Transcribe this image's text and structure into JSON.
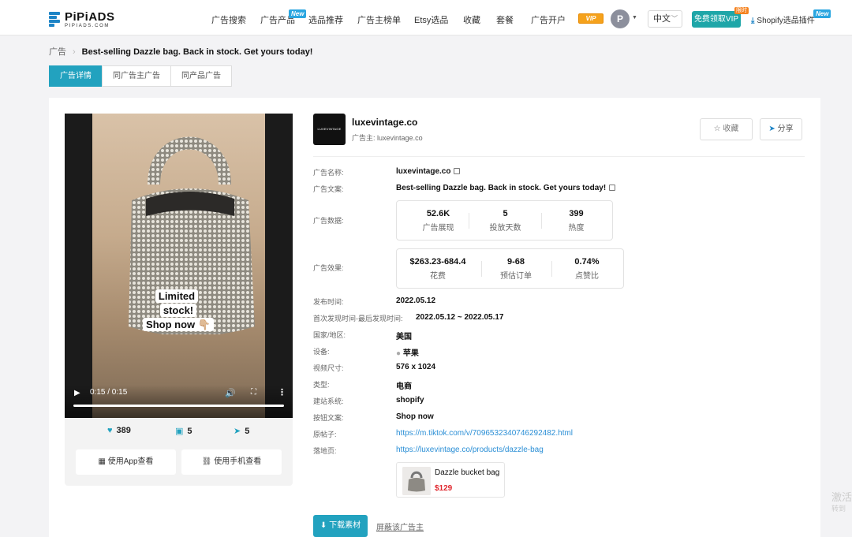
{
  "header": {
    "logo_name": "PiPiADS",
    "logo_sub": "PIPIADS.COM",
    "nav": [
      {
        "label": "广告搜索"
      },
      {
        "label": "广告产品",
        "badge": "New"
      },
      {
        "label": "选品推荐"
      },
      {
        "label": "广告主榜单"
      },
      {
        "label": "Etsy选品"
      },
      {
        "label": "收藏"
      },
      {
        "label": "套餐"
      },
      {
        "label": "广告开户"
      }
    ],
    "vip_badge": "VIP",
    "avatar_letter": "P",
    "language": "中文",
    "vip_button": "免费领取VIP",
    "vip_hot": "限时",
    "shopify_plugin": "Shopify选品插件",
    "shopify_badge": "New"
  },
  "breadcrumb": {
    "root": "广告",
    "current": "Best-selling Dazzle bag. Back in stock. Get yours today!"
  },
  "tabs": [
    {
      "label": "广告详情",
      "active": true
    },
    {
      "label": "同广告主广告",
      "active": false
    },
    {
      "label": "同产品广告",
      "active": false
    }
  ],
  "video": {
    "caption_line1": "Limited stock!",
    "caption_line2": "Shop now 👇🏼",
    "time": "0:15 / 0:15",
    "progress": 1.0
  },
  "engagement": {
    "likes": "389",
    "comments": "5",
    "shares": "5"
  },
  "media_buttons": {
    "app": "使用App查看",
    "phone": "使用手机查看"
  },
  "advertiser": {
    "logo_text": "LUXEVINTAGE",
    "name": "luxevintage.co",
    "sub_label": "广告主:",
    "sub_value": "luxevintage.co"
  },
  "actions": {
    "favorite": "收藏",
    "share": "分享"
  },
  "details": {
    "ad_name_label": "广告名称:",
    "ad_name": "luxevintage.co",
    "ad_copy_label": "广告文案:",
    "ad_copy": "Best-selling Dazzle bag. Back in stock. Get yours today!",
    "ad_data_label": "广告数据:",
    "ad_data": [
      {
        "value": "52.6K",
        "label": "广告展现"
      },
      {
        "value": "5",
        "label": "投放天数"
      },
      {
        "value": "399",
        "label": "热度"
      }
    ],
    "ad_effect_label": "广告效果:",
    "ad_effect": [
      {
        "value": "$263.23-684.4",
        "label": "花费"
      },
      {
        "value": "9-68",
        "label": "预估订单"
      },
      {
        "value": "0.74%",
        "label": "点赞比"
      }
    ],
    "publish_label": "发布时间:",
    "publish": "2022.05.12",
    "first_last_label": "首次发现时间-最后发现时间:",
    "first_last": "2022.05.12 ~ 2022.05.17",
    "country_label": "国家/地区:",
    "country": "美国",
    "device_label": "设备:",
    "device": "苹果",
    "size_label": "视频尺寸:",
    "size": "576 x 1024",
    "type_label": "类型:",
    "type": "电商",
    "site_label": "建站系统:",
    "site": "shopify",
    "button_label": "按钮文案:",
    "button": "Shop now",
    "post_label": "原帖子:",
    "post": "https://m.tiktok.com/v/7096532340746292482.html",
    "landing_label": "落地页:",
    "landing": "https://luxevintage.co/products/dazzle-bag"
  },
  "product": {
    "name": "Dazzle bucket bag",
    "price": "$129"
  },
  "bottom": {
    "download": "下载素材",
    "block": "屏蔽该广告主"
  },
  "watermark": {
    "line1": "激活",
    "line2": "转到"
  },
  "colors": {
    "accent": "#22a2bf",
    "link": "#2b8fd6",
    "price": "#e0262d"
  }
}
